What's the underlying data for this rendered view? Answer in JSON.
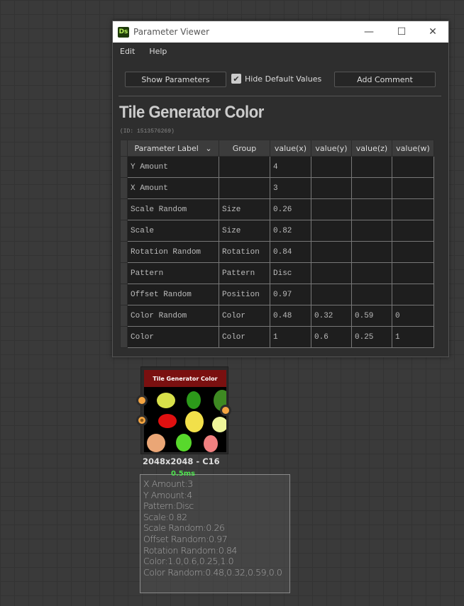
{
  "window": {
    "title": "Parameter Viewer",
    "logo": "Ds",
    "minimize_icon": "—",
    "maximize_icon": "☐",
    "close_icon": "✕"
  },
  "menu": [
    "Edit",
    "Help"
  ],
  "toolbar": {
    "show_parameters": "Show Parameters",
    "hide_default_values": "Hide Default Values",
    "hide_default_checked": true,
    "add_comment": "Add Comment"
  },
  "node_title": "Tile Generator Color",
  "node_id": "(ID: 1513576269)",
  "table": {
    "headers": [
      "Parameter Label",
      "Group",
      "value(x)",
      "value(y)",
      "value(z)",
      "value(w)"
    ],
    "sort_icon": "⌄",
    "rows": [
      [
        "Y Amount",
        "",
        "4",
        "",
        "",
        ""
      ],
      [
        "X Amount",
        "",
        "3",
        "",
        "",
        ""
      ],
      [
        "Scale Random",
        "Size",
        "0.26",
        "",
        "",
        ""
      ],
      [
        "Scale",
        "Size",
        "0.82",
        "",
        "",
        ""
      ],
      [
        "Rotation Random",
        "Rotation",
        "0.84",
        "",
        "",
        ""
      ],
      [
        "Pattern",
        "Pattern",
        "Disc",
        "",
        "",
        ""
      ],
      [
        "Offset Random",
        "Position",
        "0.97",
        "",
        "",
        ""
      ],
      [
        "Color Random",
        "Color",
        "0.48",
        "0.32",
        "0.59",
        "0"
      ],
      [
        "Color",
        "Color",
        "1",
        "0.6",
        "0.25",
        "1"
      ]
    ]
  },
  "graph_node": {
    "banner": "Tile Generator Color",
    "resolution": "2048x2048 - C16",
    "time": "0.5ms"
  },
  "comment_lines": [
    "X Amount:3",
    "Y Amount:4",
    "Pattern:Disc",
    "Scale:0.82",
    "Scale Random:0.26",
    "Offset Random:0.97",
    "Rotation Random:0.84",
    "Color:1.0,0.6,0.25,1.0",
    "Color Random:0.48,0.32,0.59,0.0"
  ]
}
